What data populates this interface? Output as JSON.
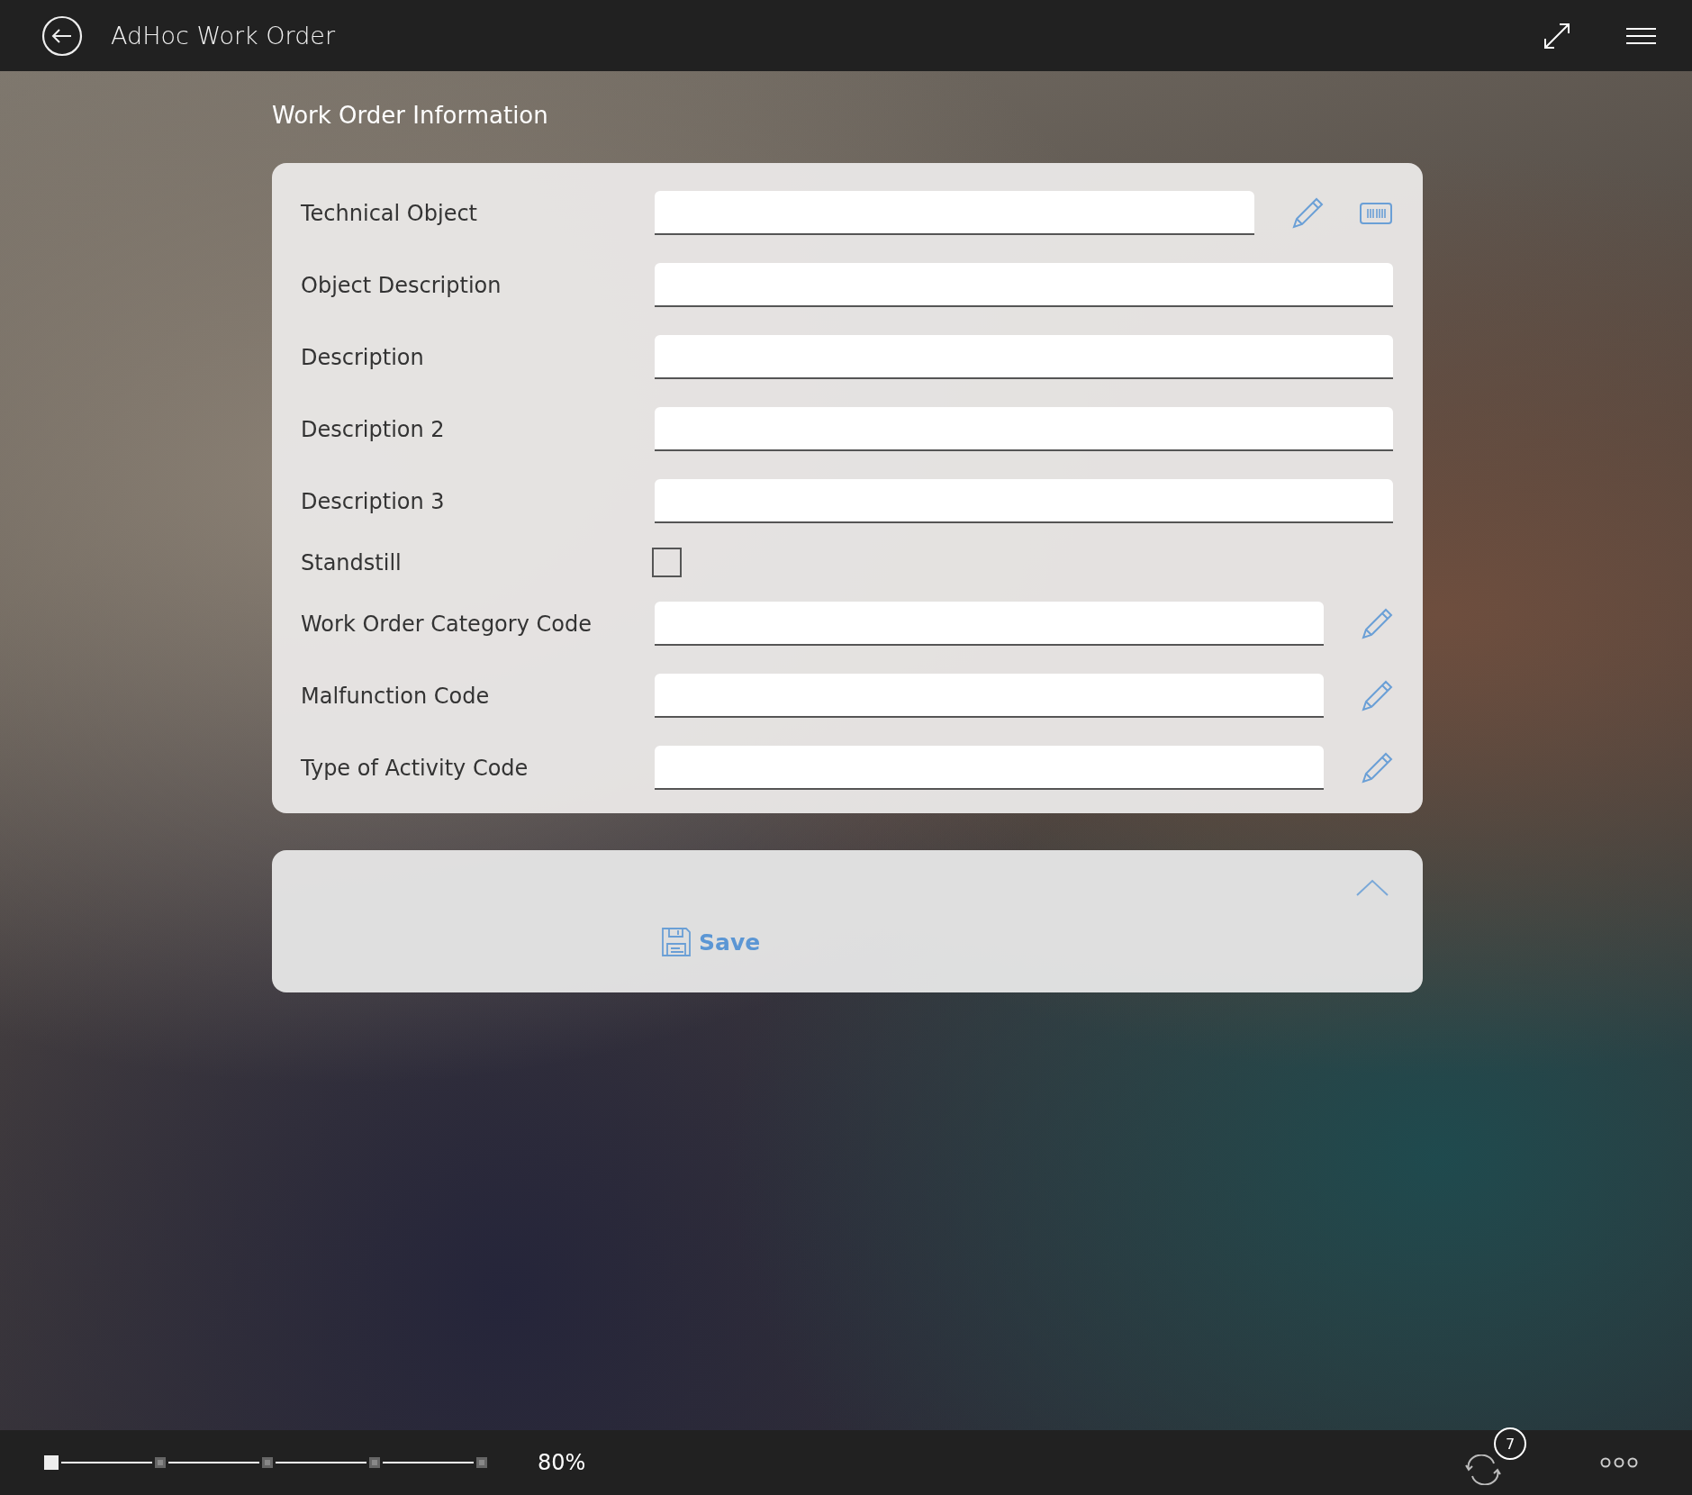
{
  "app_bar": {
    "title": "AdHoc Work Order"
  },
  "section_title": "Work Order Information",
  "fields": [
    {
      "label": "Technical Object",
      "kind": "lookup_scan"
    },
    {
      "label": "Object Description",
      "kind": "text"
    },
    {
      "label": "Description",
      "kind": "text"
    },
    {
      "label": "Description 2",
      "kind": "text"
    },
    {
      "label": "Description 3",
      "kind": "text"
    },
    {
      "label": "Standstill",
      "kind": "checkbox",
      "checked": false
    },
    {
      "label": "Work Order Category Code",
      "kind": "lookup"
    },
    {
      "label": "Malfunction Code",
      "kind": "lookup"
    },
    {
      "label": "Type of Activity Code",
      "kind": "lookup"
    }
  ],
  "actions": {
    "expanded": false,
    "save_label": "Save"
  },
  "bottom_bar": {
    "zoom_stops": [
      {
        "selected": true
      },
      {
        "selected": false
      },
      {
        "selected": false
      },
      {
        "selected": false
      },
      {
        "selected": false
      }
    ],
    "zoom_reading": "80%",
    "sync_count": "7"
  }
}
